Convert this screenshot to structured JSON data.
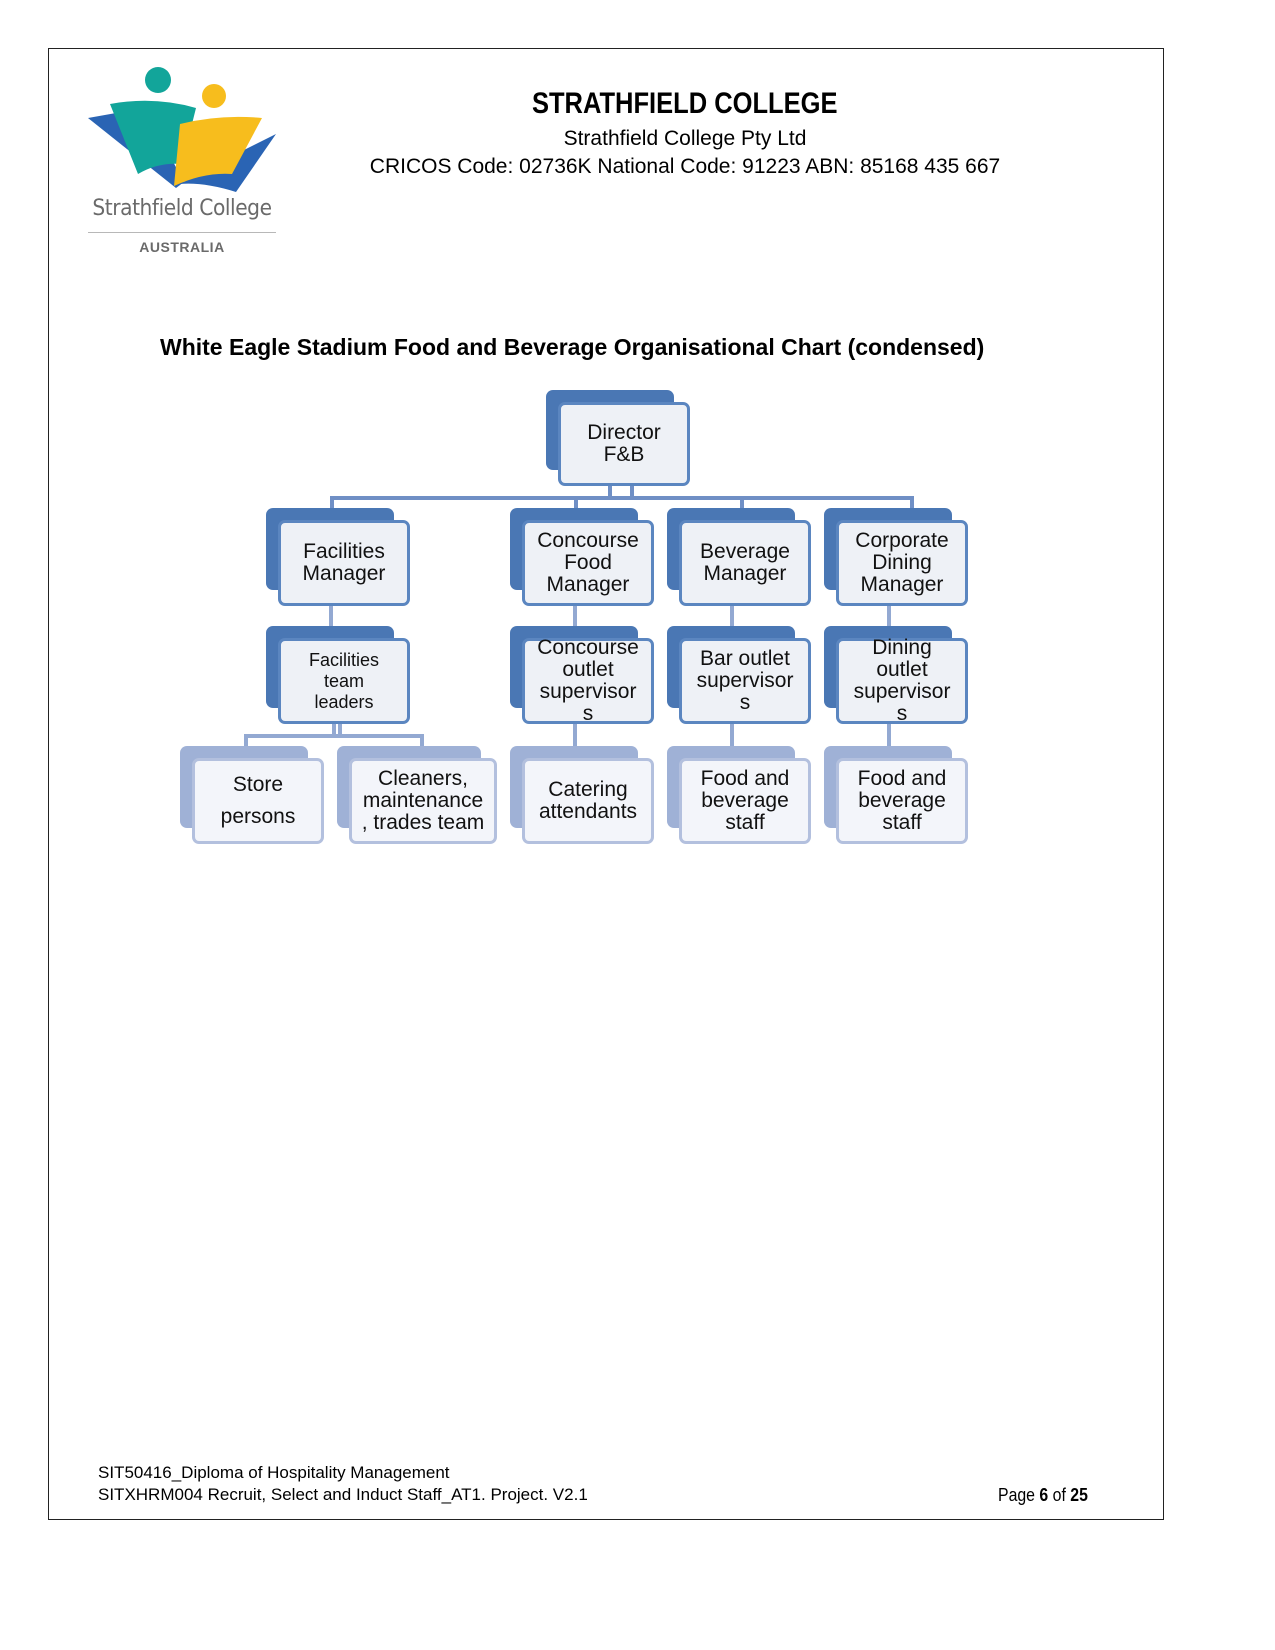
{
  "header": {
    "logo": {
      "name": "Strathfield College",
      "country": "AUSTRALIA",
      "colors": {
        "teal": "#12a59a",
        "yellow": "#f7bd1d",
        "blue": "#2a64b4"
      }
    },
    "title": "STRATHFIELD COLLEGE",
    "subtitle": "Strathfield College Pty Ltd",
    "codes": "CRICOS Code: 02736K National Code: 91223 ABN: 85168 435 667"
  },
  "chart_title": "White Eagle Stadium Food and Beverage Organisational Chart (condensed)",
  "org_chart": {
    "colors": {
      "dark": "#4a77b4",
      "light": "#9fb1d6",
      "box_fill": "#eef1f6",
      "connector": "#93a9d2"
    },
    "root": {
      "label": "Director F&B"
    },
    "managers": [
      {
        "label": "Facilities Manager"
      },
      {
        "label": "Concourse Food Manager"
      },
      {
        "label": "Beverage Manager"
      },
      {
        "label": "Corporate Dining Manager"
      }
    ],
    "supervisors": [
      {
        "label": "Facilities team leaders"
      },
      {
        "label": "Concourse outlet supervisor s"
      },
      {
        "label": "Bar outlet supervisor s"
      },
      {
        "label": "Dining outlet supervisor s"
      }
    ],
    "staff": [
      {
        "label": "Store persons"
      },
      {
        "label": "Cleaners, maintenance , trades team"
      },
      {
        "label": "Catering attendants"
      },
      {
        "label": "Food and beverage staff"
      },
      {
        "label": "Food and beverage staff"
      }
    ]
  },
  "footer": {
    "line1": "SIT50416_Diploma of Hospitality Management",
    "line2": "SITXHRM004 Recruit, Select and Induct Staff_AT1. Project. V2.1",
    "page_prefix": "Page",
    "page_current": "6",
    "page_of": "of",
    "page_total": "25"
  }
}
